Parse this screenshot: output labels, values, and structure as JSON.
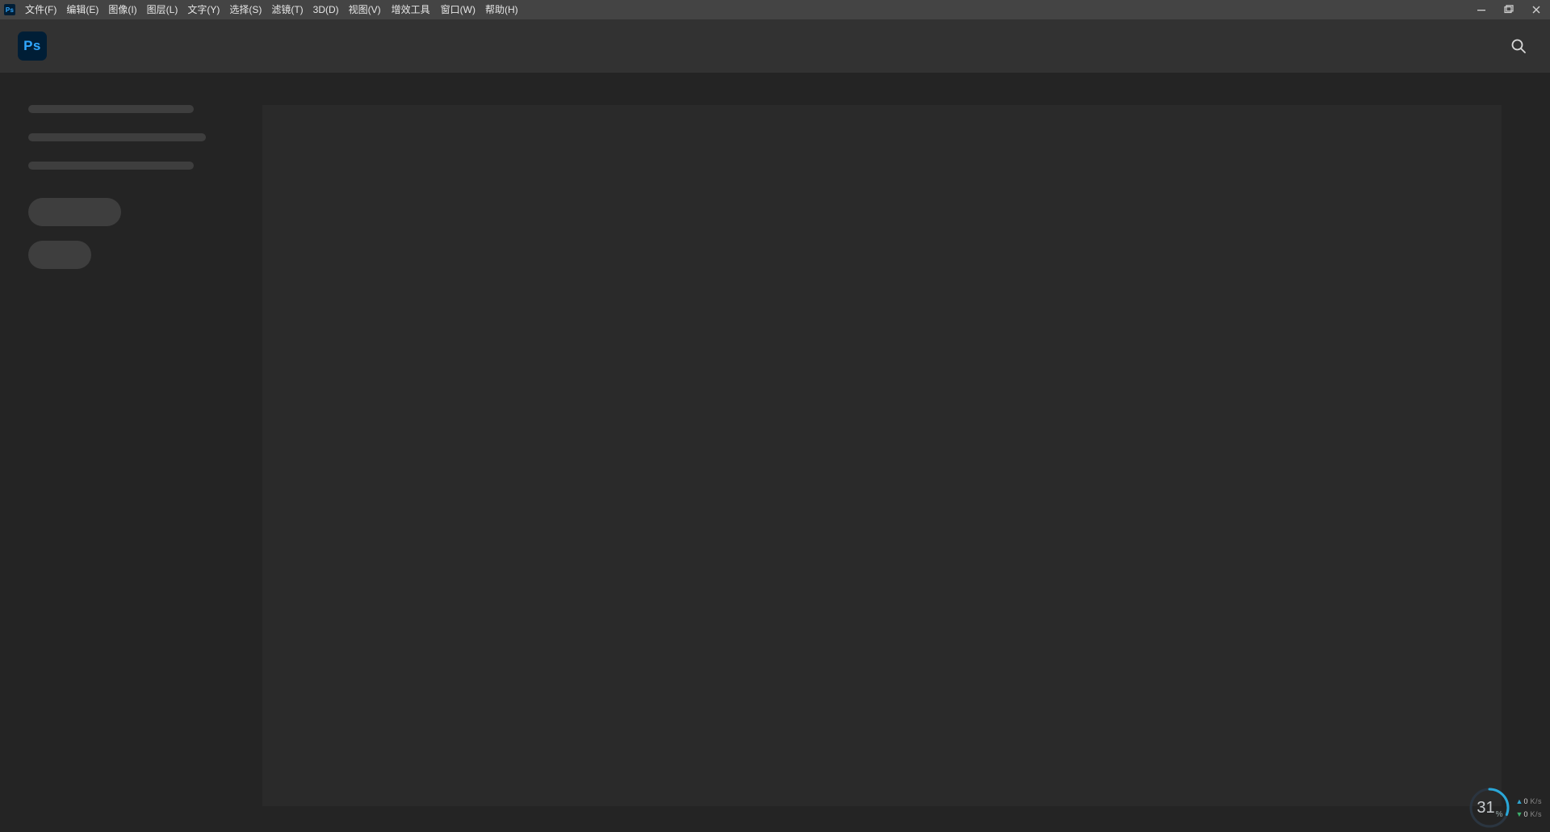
{
  "app": {
    "badge_text": "Ps",
    "logo_text": "Ps"
  },
  "menubar": {
    "items": [
      "文件(F)",
      "编辑(E)",
      "图像(I)",
      "图层(L)",
      "文字(Y)",
      "选择(S)",
      "滤镜(T)",
      "3D(D)",
      "视图(V)",
      "增效工具",
      "窗口(W)",
      "帮助(H)"
    ]
  },
  "window_controls": {
    "minimize": "minimize",
    "maximize": "maximize",
    "close": "close"
  },
  "search": {
    "icon": "search-icon"
  },
  "overlay": {
    "gauge_value": "31",
    "gauge_unit": "%",
    "upload_value": "0",
    "upload_unit": "K/s",
    "download_value": "0",
    "download_unit": "K/s"
  },
  "colors": {
    "ps_blue": "#31a8ff",
    "ps_dark": "#001e36",
    "gauge_ring": "#2aa7d8"
  }
}
